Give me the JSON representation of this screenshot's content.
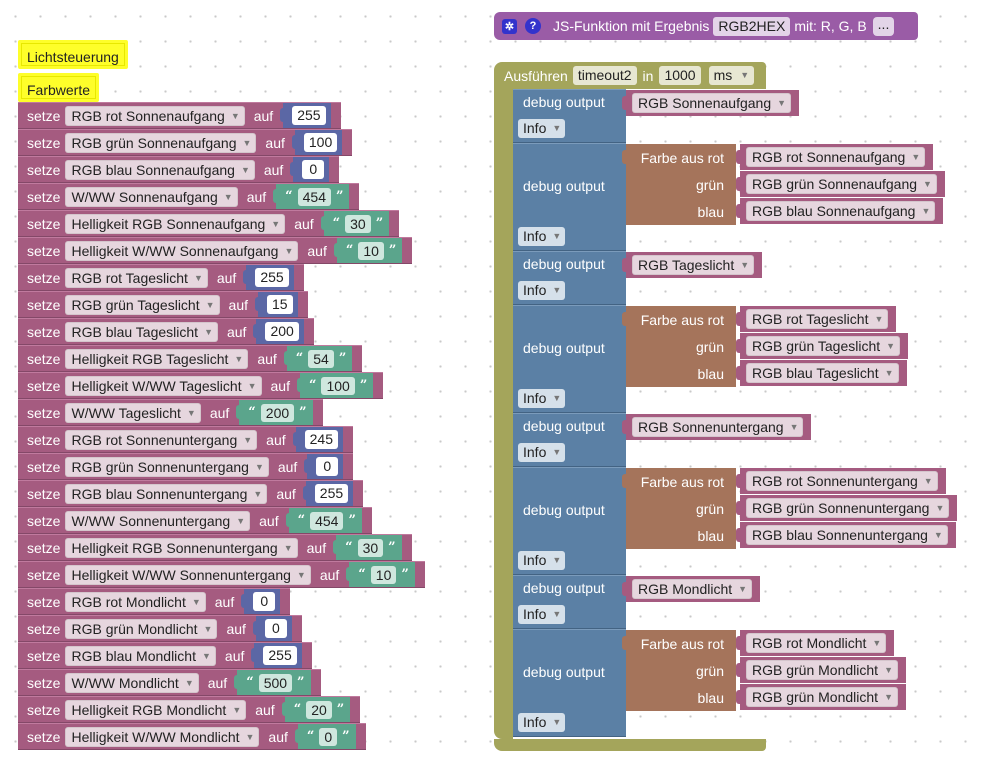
{
  "comments": [
    "Lichtsteuerung",
    "Farbwerte"
  ],
  "setze": [
    {
      "kw": "setze",
      "var": "RGB rot Sonnenaufgang",
      "auf": "auf",
      "kind": "num",
      "value": "255"
    },
    {
      "kw": "setze",
      "var": "RGB grün Sonnenaufgang",
      "auf": "auf",
      "kind": "num",
      "value": "100"
    },
    {
      "kw": "setze",
      "var": "RGB blau Sonnenaufgang",
      "auf": "auf",
      "kind": "num",
      "value": "0"
    },
    {
      "kw": "setze",
      "var": "W/WW Sonnenaufgang",
      "auf": "auf",
      "kind": "str",
      "value": "454"
    },
    {
      "kw": "setze",
      "var": "Helligkeit RGB Sonnenaufgang",
      "auf": "auf",
      "kind": "str",
      "value": "30"
    },
    {
      "kw": "setze",
      "var": "Helligkeit W/WW Sonnenaufgang",
      "auf": "auf",
      "kind": "str",
      "value": "10"
    },
    {
      "kw": "setze",
      "var": "RGB rot Tageslicht",
      "auf": "auf",
      "kind": "num",
      "value": "255"
    },
    {
      "kw": "setze",
      "var": "RGB grün Tageslicht",
      "auf": "auf",
      "kind": "num",
      "value": "15"
    },
    {
      "kw": "setze",
      "var": "RGB blau Tageslicht",
      "auf": "auf",
      "kind": "num",
      "value": "200"
    },
    {
      "kw": "setze",
      "var": "Helligkeit RGB Tageslicht",
      "auf": "auf",
      "kind": "str",
      "value": "54"
    },
    {
      "kw": "setze",
      "var": "Helligkeit W/WW Tageslicht",
      "auf": "auf",
      "kind": "str",
      "value": "100"
    },
    {
      "kw": "setze",
      "var": "W/WW Tageslicht",
      "auf": "auf",
      "kind": "str",
      "value": "200"
    },
    {
      "kw": "setze",
      "var": "RGB rot Sonnenuntergang",
      "auf": "auf",
      "kind": "num",
      "value": "245"
    },
    {
      "kw": "setze",
      "var": "RGB grün Sonnenuntergang",
      "auf": "auf",
      "kind": "num",
      "value": "0"
    },
    {
      "kw": "setze",
      "var": "RGB blau Sonnenuntergang",
      "auf": "auf",
      "kind": "num",
      "value": "255"
    },
    {
      "kw": "setze",
      "var": "W/WW Sonnenuntergang",
      "auf": "auf",
      "kind": "str",
      "value": "454"
    },
    {
      "kw": "setze",
      "var": "Helligkeit RGB Sonnenuntergang",
      "auf": "auf",
      "kind": "str",
      "value": "30"
    },
    {
      "kw": "setze",
      "var": "Helligkeit W/WW Sonnenuntergang",
      "auf": "auf",
      "kind": "str",
      "value": "10"
    },
    {
      "kw": "setze",
      "var": "RGB rot Mondlicht",
      "auf": "auf",
      "kind": "num",
      "value": "0"
    },
    {
      "kw": "setze",
      "var": "RGB grün Mondlicht",
      "auf": "auf",
      "kind": "num",
      "value": "0"
    },
    {
      "kw": "setze",
      "var": "RGB blau Mondlicht",
      "auf": "auf",
      "kind": "num",
      "value": "255"
    },
    {
      "kw": "setze",
      "var": "W/WW Mondlicht",
      "auf": "auf",
      "kind": "str",
      "value": "500"
    },
    {
      "kw": "setze",
      "var": "Helligkeit RGB Mondlicht",
      "auf": "auf",
      "kind": "str",
      "value": "20"
    },
    {
      "kw": "setze",
      "var": "Helligkeit W/WW Mondlicht",
      "auf": "auf",
      "kind": "str",
      "value": "0"
    }
  ],
  "quote_open": "“",
  "quote_close": "”",
  "func": {
    "label": "JS-Funktion mit Ergebnis",
    "name": "RGB2HEX",
    "params": "mit: R, G, B",
    "more": "...",
    "help_glyph": "?"
  },
  "timeout": {
    "run_label": "Ausführen",
    "name": "timeout2",
    "in_label": "in",
    "delay": "1000",
    "unit": "ms"
  },
  "debug_label": "debug output",
  "info_label": "Info",
  "color_labels": {
    "from": "Farbe aus rot",
    "green": "grün",
    "blue": "blau"
  },
  "debug_blocks": [
    {
      "kind": "var",
      "var": "RGB Sonnenaufgang"
    },
    {
      "kind": "color",
      "r": "RGB rot Sonnenaufgang",
      "g": "RGB grün Sonnenaufgang",
      "b": "RGB blau Sonnenaufgang"
    },
    {
      "kind": "var",
      "var": "RGB Tageslicht"
    },
    {
      "kind": "color",
      "r": "RGB rot Tageslicht",
      "g": "RGB grün Tageslicht",
      "b": "RGB blau Tageslicht"
    },
    {
      "kind": "var",
      "var": "RGB Sonnenuntergang"
    },
    {
      "kind": "color",
      "r": "RGB rot Sonnenuntergang",
      "g": "RGB grün Sonnenuntergang",
      "b": "RGB blau Sonnenuntergang"
    },
    {
      "kind": "var",
      "var": "RGB Mondlicht"
    },
    {
      "kind": "color",
      "r": "RGB rot Mondlicht",
      "g": "RGB grün Mondlicht",
      "b": "RGB grün Mondlicht"
    }
  ],
  "colors": {
    "variable_block": "#a55b80",
    "number_block": "#5b67a5",
    "text_block": "#5ba58c",
    "debug_block": "#5b80a5",
    "color_block": "#a5745b",
    "timeout_block": "#a4a55b",
    "function_block": "#9a5ca6",
    "comment": "#fefe2a"
  }
}
